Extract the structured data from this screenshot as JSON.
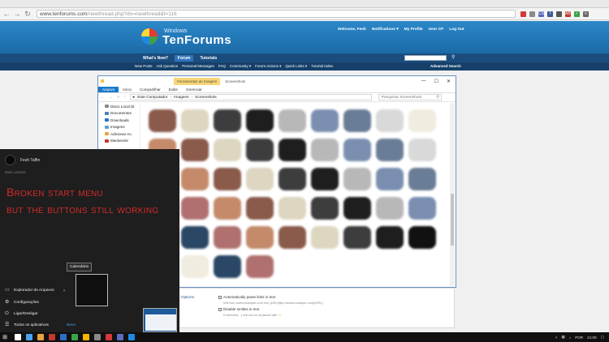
{
  "browser": {
    "url_host": "www.tenforums.com",
    "url_path": "/newthread.php?do=newthread&f=116",
    "extensions": [
      {
        "icon": "ext-circle-icon",
        "color": "#d23a3a",
        "label": ""
      },
      {
        "icon": "ext-grid-icon",
        "color": "#8a8a8a",
        "label": ""
      },
      {
        "icon": "ext-css-icon",
        "color": "#5b6abf",
        "label": "CSS"
      },
      {
        "icon": "ext-f-icon",
        "color": "#3b5998",
        "label": "f"
      },
      {
        "icon": "ext-shield-icon",
        "color": "#555555",
        "label": ""
      },
      {
        "icon": "ext-abp-icon",
        "color": "#c0392b",
        "label": "ABP"
      },
      {
        "icon": "ext-check-icon",
        "color": "#3aa34a",
        "label": "✓"
      },
      {
        "icon": "menu-icon",
        "color": "#666666",
        "label": "≡"
      }
    ]
  },
  "forum": {
    "logo_small": "Windows",
    "logo_text": "TenForums",
    "user_links": [
      "Welcome, Fesh",
      "Notifications ▾",
      "My Profile",
      "User CP",
      "Log Out"
    ],
    "nav": [
      "What's New?",
      "Forum",
      "Tutorials"
    ],
    "subnav": [
      "New Posts",
      "Ask Question",
      "Personal Messages",
      "FAQ",
      "Community ▾",
      "Forum Actions ▾",
      "Quick Links ▾",
      "Tutorial Index"
    ],
    "advanced_search": "Advanced Search"
  },
  "explorer": {
    "ribbon_tool": "Ferramentas de Imagem",
    "title": "Screenshots",
    "tabs": [
      "Arquivo",
      "Início",
      "Compartilhar",
      "Exibir",
      "Gerenciar"
    ],
    "path": [
      "Este Computador",
      "Imagens",
      "Screenshots"
    ],
    "search_placeholder": "Pesquisar Screenshots",
    "nav_items": [
      {
        "label": "Disco Local (E",
        "color": "#888888"
      },
      {
        "label": "Documentos",
        "color": "#4a7fc1"
      },
      {
        "label": "Downloads",
        "color": "#2b6fc4"
      },
      {
        "label": "Imagens",
        "color": "#5a9fd4"
      },
      {
        "label": "Adicionar Au",
        "color": "#e8a33c"
      },
      {
        "label": "Mackenzie",
        "color": "#c0392b"
      }
    ]
  },
  "form": {
    "options_label": "Options:",
    "opt1": "Automatically parse links in text",
    "opt1_note": "Will turn www.example.com into [URL]http://www.example.com[/URL].",
    "opt2": "Disable smilies in text",
    "opt2_note": "If selected, :) will not be replaced with"
  },
  "start_menu": {
    "user_name": "Fesh Taffin",
    "subtitle": "Mais usados",
    "caption_line1": "Broken start menu",
    "caption_line2": "but the buttons still working",
    "tooltip": "Calendário",
    "items": [
      {
        "label": "Explorador de Arquivos",
        "icon": "folder-icon"
      },
      {
        "label": "Configurações",
        "icon": "gear-icon"
      },
      {
        "label": "Ligar/Desligar",
        "icon": "power-icon"
      },
      {
        "label": "Todos os aplicativos",
        "icon": "list-icon"
      }
    ],
    "new_badge": "Novo"
  },
  "taskbar": {
    "lang": "POR",
    "time": "21:09",
    "apps": [
      "#ffffff",
      "#4aa3f0",
      "#e8a33c",
      "#c0392b",
      "#2b6fc4",
      "#3aa34a",
      "#f4b400",
      "#888888",
      "#d23a3a",
      "#5b6abf",
      "#1e88e5"
    ]
  }
}
